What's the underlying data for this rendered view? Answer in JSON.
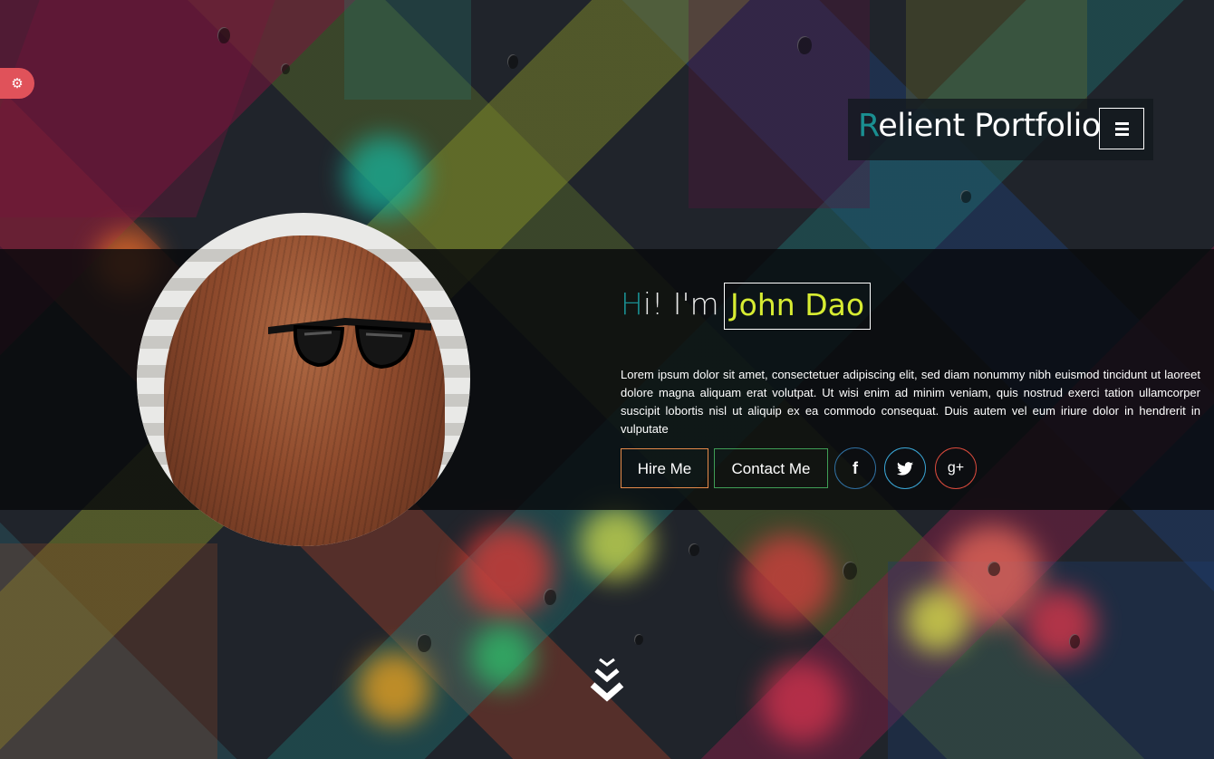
{
  "settings": {
    "icon": "gear-icon",
    "glyph": "⚙"
  },
  "header": {
    "brand_first_letter": "R",
    "brand_rest": "elient Portfolio",
    "menu_icon": "hamburger-icon"
  },
  "hero": {
    "greeting_first_letter": "H",
    "greeting_rest": "i! I'm",
    "name": "John Dao",
    "bio": "Lorem ipsum dolor sit amet, consectetuer adipiscing elit, sed diam nonummy nibh euismod tincidunt ut laoreet dolore magna aliquam erat volutpat. Ut wisi enim ad minim veniam, quis nostrud exerci tation ullamcorper suscipit lobortis nisl ut aliquip ex ea commodo consequat. Duis autem vel eum iriure dolor in hendrerit in vulputate",
    "buttons": {
      "hire": "Hire Me",
      "contact": "Contact Me"
    },
    "social": {
      "facebook": "f",
      "twitter": "t",
      "googleplus": "g+"
    }
  },
  "colors": {
    "accent_teal": "#1a8f91",
    "name_yellow": "#d7ec32",
    "hire_border": "#e58a4a",
    "contact_border": "#3f9e56",
    "facebook_border": "#2f6fa0",
    "twitter_border": "#3aa6d6",
    "googleplus_border": "#d94a3c",
    "settings_tab": "#e0525a"
  },
  "scroll": {
    "icon": "chevrons-down-icon"
  }
}
